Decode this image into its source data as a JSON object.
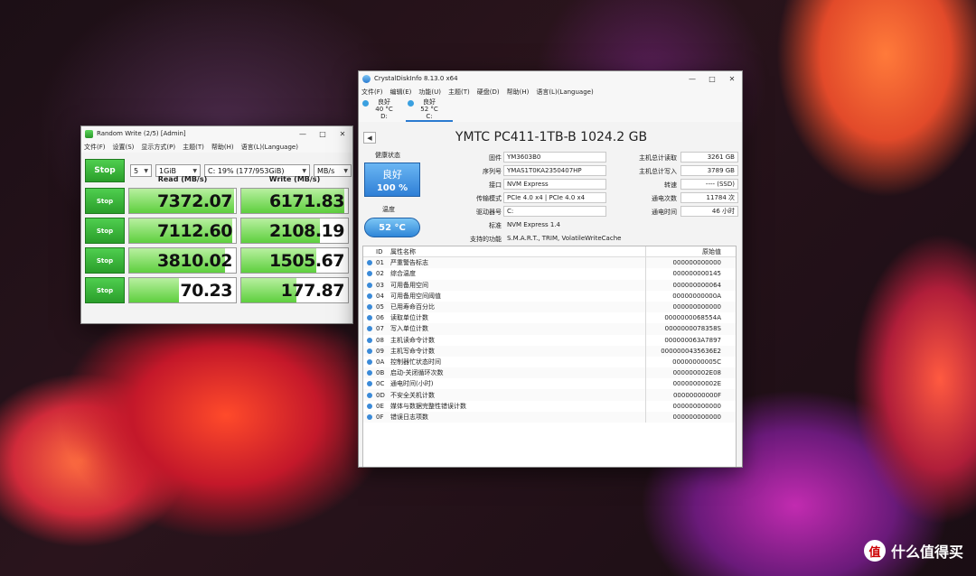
{
  "cdm": {
    "title": "Random Write (2/5) [Admin]",
    "menu": [
      "文件(F)",
      "设置(S)",
      "显示方式(P)",
      "主题(T)",
      "帮助(H)",
      "语言(L)(Language)"
    ],
    "main_button": "Stop",
    "count": "5",
    "size": "1GiB",
    "drive": "C: 19% (177/953GiB)",
    "unit": "MB/s",
    "read_header": "Read (MB/s)",
    "write_header": "Write (MB/s)",
    "rows": [
      {
        "button": "Stop",
        "read": "7372.07",
        "write": "6171.83",
        "read_fill": 0.98,
        "write_fill": 0.97
      },
      {
        "button": "Stop",
        "read": "7112.60",
        "write": "2108.19",
        "read_fill": 0.97,
        "write_fill": 0.74
      },
      {
        "button": "Stop",
        "read": "3810.02",
        "write": "1505.67",
        "read_fill": 0.9,
        "write_fill": 0.7
      },
      {
        "button": "Stop",
        "read": "70.23",
        "write": "177.87",
        "read_fill": 0.47,
        "write_fill": 0.52
      }
    ]
  },
  "cdi": {
    "title": "CrystalDiskInfo 8.13.0 x64",
    "menu": [
      "文件(F)",
      "编辑(E)",
      "功能(U)",
      "主题(T)",
      "硬盘(D)",
      "帮助(H)",
      "语言(L)(Language)"
    ],
    "drives": [
      {
        "status": "良好",
        "temp": "40 °C",
        "letter": "D:"
      },
      {
        "status": "良好",
        "temp": "52 °C",
        "letter": "C:"
      }
    ],
    "model": "YMTC PC411-1TB-B 1024.2 GB",
    "health_label": "健康状态",
    "health_status": "良好",
    "health_percent": "100 %",
    "temp_label": "温度",
    "temp_value": "52 °C",
    "fields": {
      "firmware_label": "固件",
      "firmware": "YM3603B0",
      "serial_label": "序列号",
      "serial": "YMAS1T0KA2350407HP",
      "interface_label": "接口",
      "interface": "NVM Express",
      "transfer_label": "传输模式",
      "transfer": "PCIe 4.0 x4 | PCIe 4.0 x4",
      "driveletter_label": "驱动器号",
      "driveletter": "C:",
      "standard_label": "标准",
      "standard": "NVM Express 1.4",
      "features_label": "支持的功能",
      "features": "S.M.A.R.T., TRIM, VolatileWriteCache",
      "host_reads_label": "主机总计读取",
      "host_reads": "3261 GB",
      "host_writes_label": "主机总计写入",
      "host_writes": "3789 GB",
      "rotation_label": "转速",
      "rotation": "---- (SSD)",
      "power_count_label": "通电次数",
      "power_count": "11784 次",
      "power_hours_label": "通电时间",
      "power_hours": "46 小时"
    },
    "table_headers": {
      "id": "ID",
      "name": "属性名称",
      "raw": "原始值"
    },
    "attributes": [
      {
        "id": "01",
        "name": "严重警告标志",
        "raw": "000000000000"
      },
      {
        "id": "02",
        "name": "综合温度",
        "raw": "000000000145"
      },
      {
        "id": "03",
        "name": "可用备用空间",
        "raw": "000000000064"
      },
      {
        "id": "04",
        "name": "可用备用空间阈值",
        "raw": "00000000000A"
      },
      {
        "id": "05",
        "name": "已用寿命百分比",
        "raw": "000000000000"
      },
      {
        "id": "06",
        "name": "读取单位计数",
        "raw": "0000000068554A"
      },
      {
        "id": "07",
        "name": "写入单位计数",
        "raw": "0000000078358S"
      },
      {
        "id": "08",
        "name": "主机读命令计数",
        "raw": "000000063A7897"
      },
      {
        "id": "09",
        "name": "主机写命令计数",
        "raw": "0000000435636E2"
      },
      {
        "id": "0A",
        "name": "控制器忙状态时间",
        "raw": "00000000005C"
      },
      {
        "id": "0B",
        "name": "启动-关闭循环次数",
        "raw": "000000002E08"
      },
      {
        "id": "0C",
        "name": "通电时间(小时)",
        "raw": "00000000002E"
      },
      {
        "id": "0D",
        "name": "不安全关机计数",
        "raw": "00000000000F"
      },
      {
        "id": "0E",
        "name": "媒体与数据完整性错误计数",
        "raw": "000000000000"
      },
      {
        "id": "0F",
        "name": "错误日志项数",
        "raw": "000000000000"
      }
    ]
  },
  "watermark": {
    "badge": "值",
    "text": "什么值得买"
  },
  "colors": {
    "accent_blue": "#3a8ad8",
    "progress_green": "#5ecf3e",
    "health_blue": "#2f7fd6"
  }
}
